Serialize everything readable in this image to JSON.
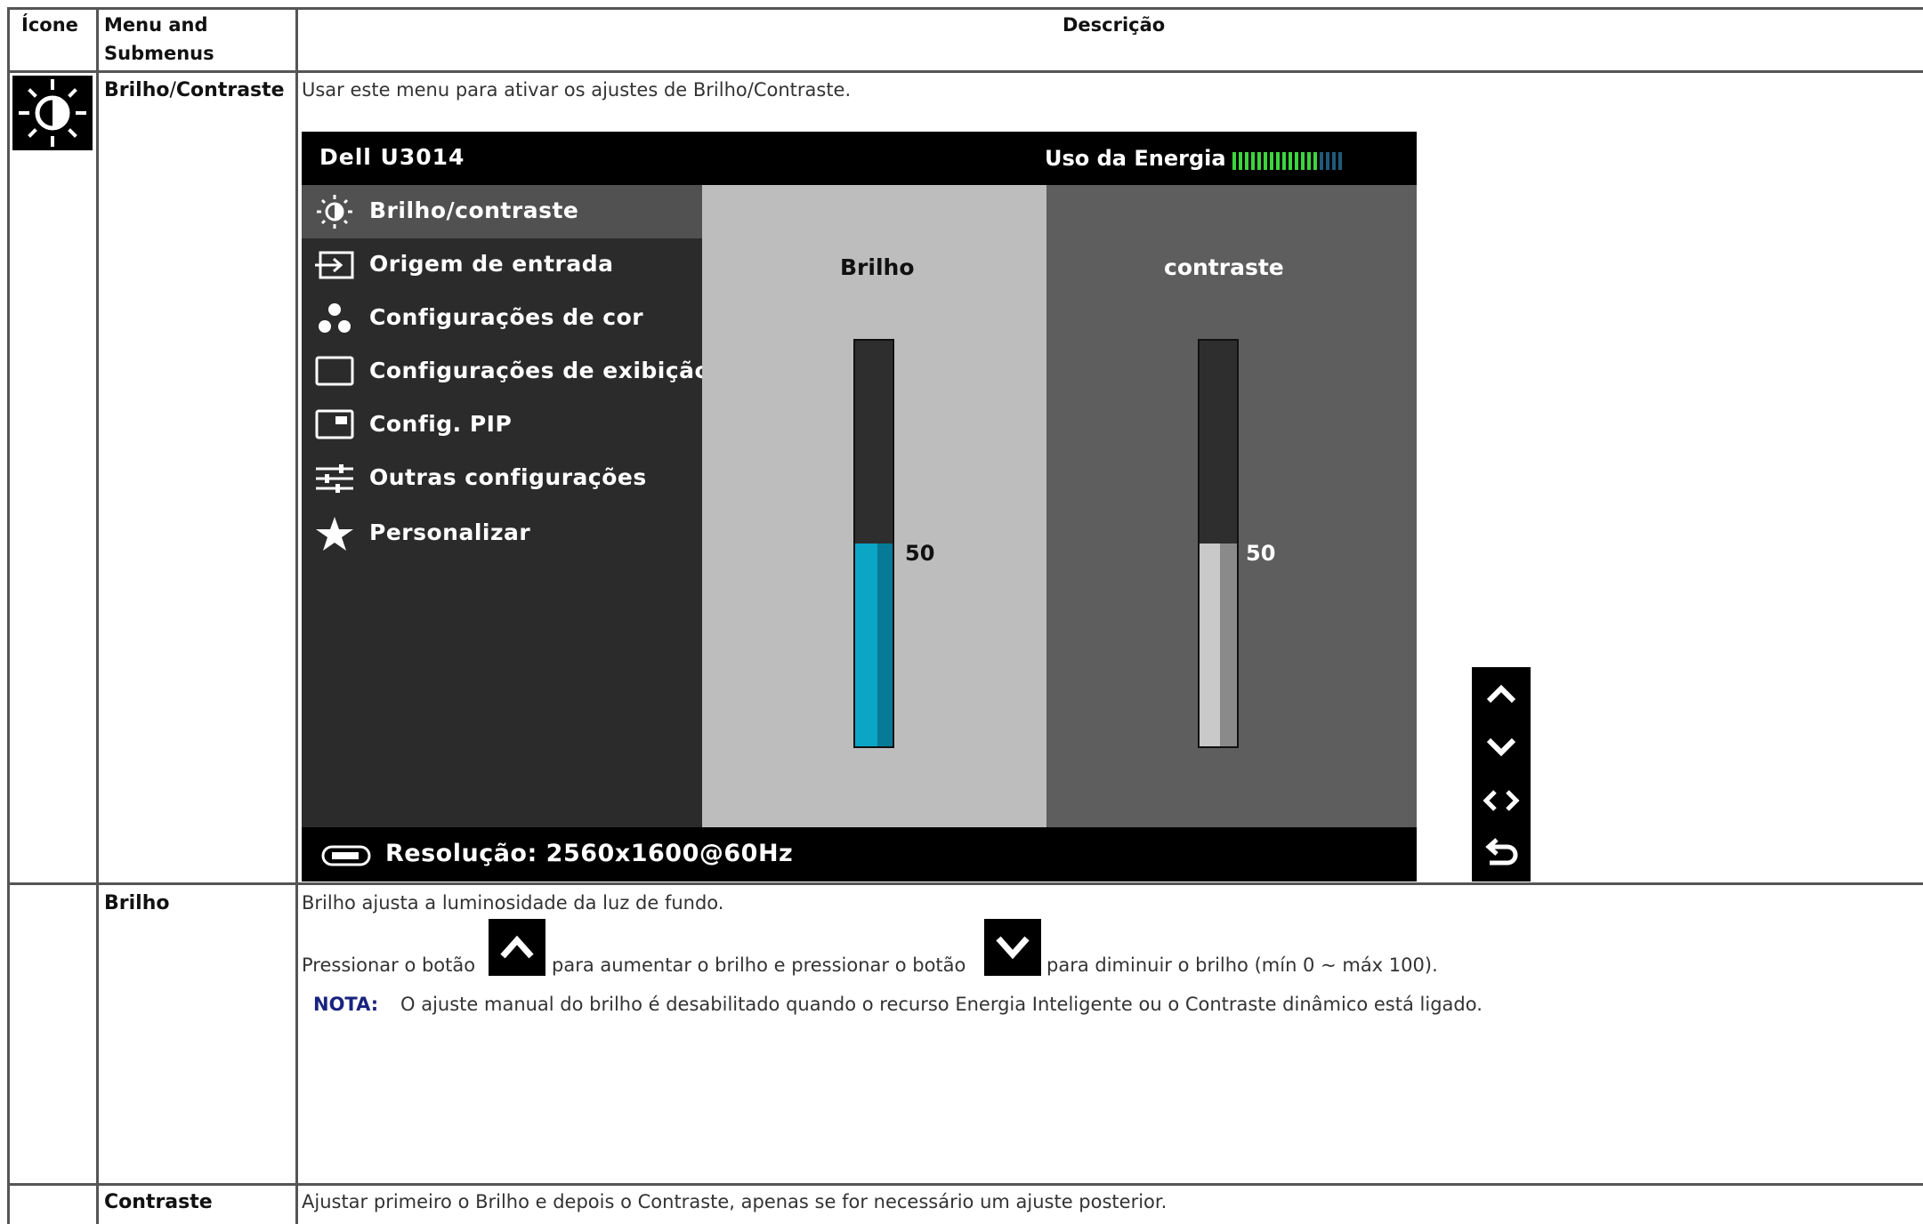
{
  "header": {
    "col_icon": "Ícone",
    "col_menu_line1": "Menu and",
    "col_menu_line2": "Submenus",
    "col_desc": "Descrição"
  },
  "row1": {
    "label_a": "Brilho",
    "label_sep": "/",
    "label_b": "Contraste",
    "intro": "Usar este menu para ativar os ajustes de Brilho/Contraste.",
    "icon": "brightness-contrast-icon"
  },
  "osd": {
    "model": "Dell U3014",
    "energy_label": "Uso da Energia",
    "energy_level_fraction": 0.78,
    "menu": [
      {
        "label": "Brilho/contraste",
        "icon": "brightness-icon",
        "selected": true
      },
      {
        "label": "Origem de entrada",
        "icon": "input-source-icon"
      },
      {
        "label": "Configurações de cor",
        "icon": "color-dots-icon"
      },
      {
        "label": "Configurações de exibição",
        "icon": "display-rect-icon"
      },
      {
        "label": "Config. PIP",
        "icon": "pip-icon"
      },
      {
        "label": "Outras configurações",
        "icon": "sliders-icon"
      },
      {
        "label": "Personalizar",
        "icon": "star-icon"
      }
    ],
    "brightness": {
      "label": "Brilho",
      "value": "50",
      "level": 50,
      "color": "#0ba6c6"
    },
    "contrast": {
      "label": "contraste",
      "value": "50",
      "level": 50,
      "color": "#c9c9c9"
    },
    "resolution": "Resolução: 2560x1600@60Hz",
    "side_buttons": [
      "up-arrow-icon",
      "down-arrow-icon",
      "left-right-arrows-icon",
      "back-arrow-icon"
    ]
  },
  "row2": {
    "label": "Brilho",
    "text1": "Brilho ajusta a luminosidade da luz de fundo.",
    "text2_a": "Pressionar o botão",
    "text2_b": "para aumentar o brilho e pressionar o botão",
    "text2_c": "para diminuir o brilho (mín 0 ~ máx 100).",
    "note_label": "NOTA:",
    "note_text": "O ajuste manual do brilho é desabilitado quando o recurso Energia Inteligente ou o Contraste dinâmico está ligado."
  },
  "row3": {
    "label": "Contraste",
    "text": "Ajustar primeiro o Brilho e depois o Contraste, apenas se for necessário um ajuste posterior."
  }
}
